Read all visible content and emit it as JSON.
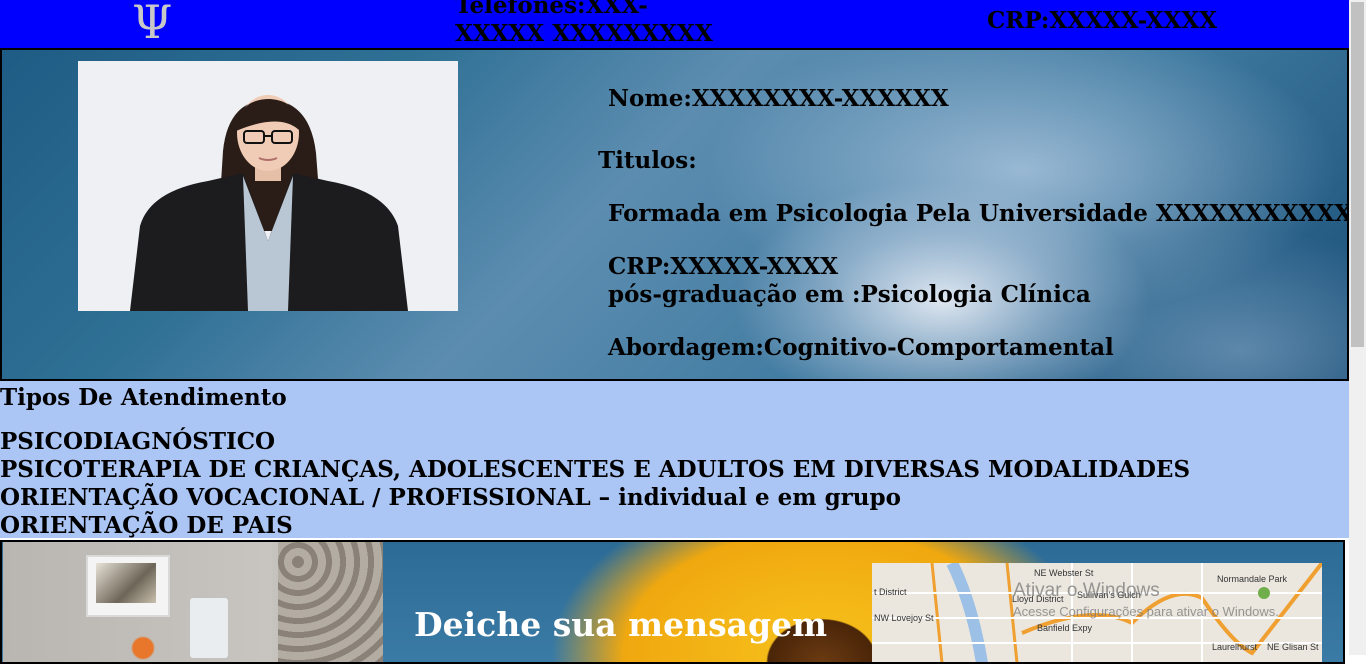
{
  "header": {
    "logo_glyph": "Ψ",
    "phones": "Telefones:XXX-XXXXX XXXXXXXXX",
    "crp": "CRP:XXXXX-XXXX"
  },
  "profile": {
    "name": "Nome:XXXXXXXX-XXXXXX",
    "titles_heading": "Titulos:",
    "degree": "Formada em Psicologia Pela Universidade XXXXXXXXXXXX",
    "crp": "CRP:XXXXX-XXXX",
    "postgrad": "pós-graduação em :Psicologia Clínica",
    "approach": "Abordagem:Cognitivo-Comportamental"
  },
  "services": {
    "title": "Tipos De Atendimento",
    "items": [
      "PSICODIAGNÓSTICO",
      "PSICOTERAPIA DE CRIANÇAS, ADOLESCENTES E ADULTOS EM DIVERSAS MODALIDADES",
      "ORIENTAÇÃO VOCACIONAL / PROFISSIONAL – individual e em grupo",
      "ORIENTAÇÃO DE PAIS"
    ]
  },
  "contact": {
    "message_heading": "Deiche sua mensagem"
  },
  "map": {
    "labels": [
      "NE Webster St",
      "Normandale Park",
      "Lloyd District",
      "Sullivan's Gulch",
      "NW Lovejoy St",
      "Banfield Expy",
      "Laurelhurst",
      "NE Glisan St",
      "t District"
    ]
  },
  "watermark": {
    "title": "Ativar o Windows",
    "subtitle": "Acesse Configurações para ativar o Windows."
  },
  "colors": {
    "topbar": "#0000ff",
    "services_bg": "#abc5f5"
  }
}
